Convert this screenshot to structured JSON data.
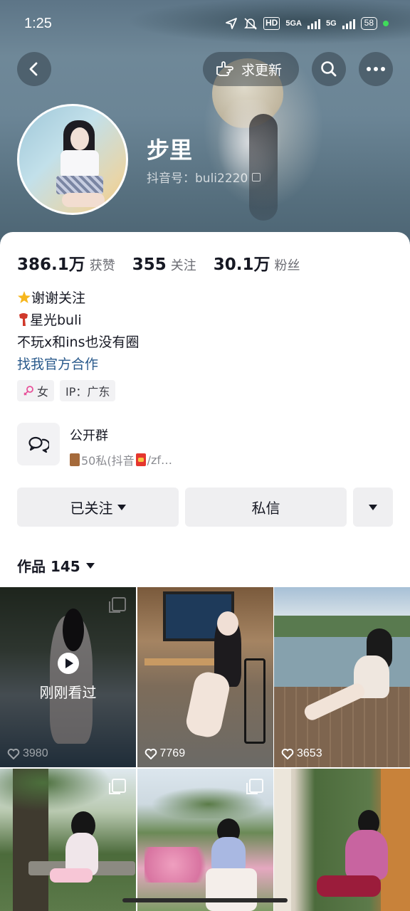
{
  "status_bar": {
    "time": "1:25",
    "network_1": "HD",
    "network_2": "5GA",
    "network_3": "5G",
    "battery": "58"
  },
  "header": {
    "update_label": "求更新"
  },
  "profile": {
    "nickname": "步里",
    "douyin_id": "抖音号：buli2220"
  },
  "stats": [
    {
      "value": "386.1万",
      "label": "获赞"
    },
    {
      "value": "355",
      "label": "关注"
    },
    {
      "value": "30.1万",
      "label": "粉丝"
    }
  ],
  "bio": {
    "line1": "谢谢关注",
    "line2": "星光buli",
    "line3": "不玩x和ins也没有圈",
    "link": "找我官方合作"
  },
  "tags": {
    "gender": "女",
    "ip": "IP：广东"
  },
  "group": {
    "title": "公开群",
    "subtitle_a": "50私(抖音",
    "subtitle_b": "/zf…"
  },
  "actions": {
    "followed": "已关注",
    "message": "私信"
  },
  "works": {
    "label": "作品 145"
  },
  "grid": {
    "watched_label": "刚刚看过",
    "items": [
      {
        "likes": "3980"
      },
      {
        "likes": "7769"
      },
      {
        "likes": "3653"
      }
    ]
  },
  "colors": {
    "accent_link": "#2a5a8c",
    "button_bg": "#efeff1",
    "text_primary": "#161823",
    "text_secondary": "#6b6c73"
  }
}
